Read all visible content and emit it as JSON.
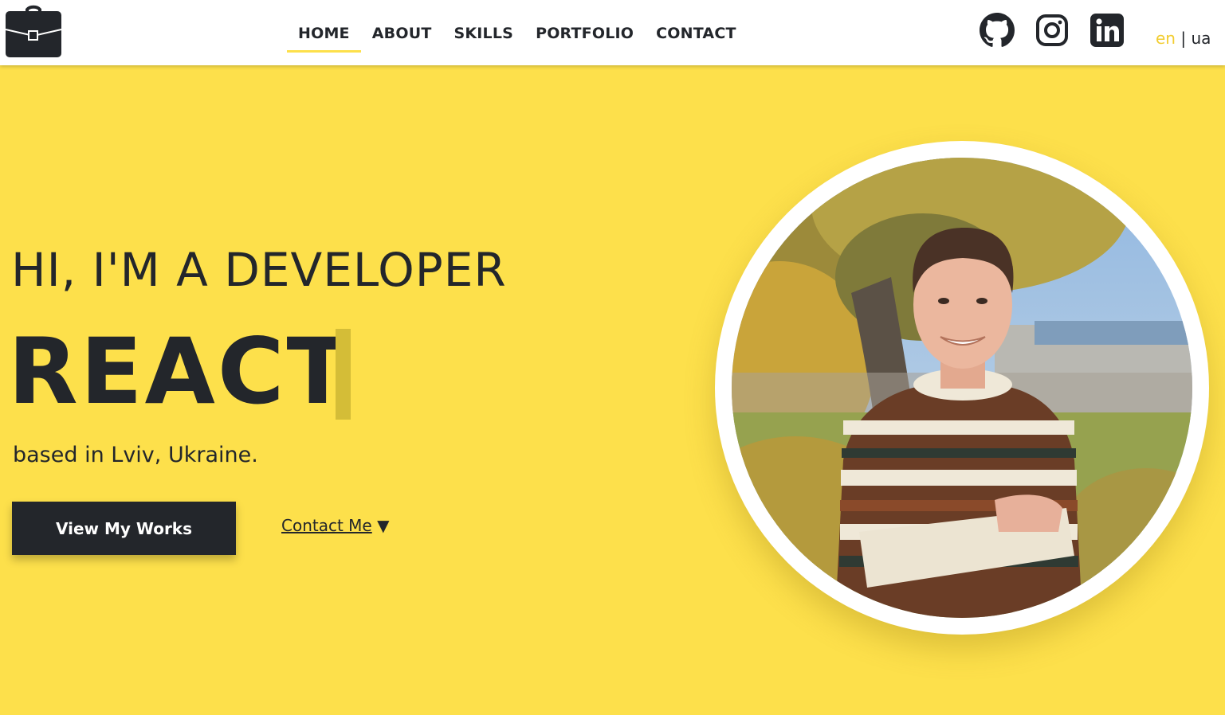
{
  "header": {
    "logo_icon": "briefcase-icon",
    "nav": [
      {
        "label": "HOME",
        "active": true
      },
      {
        "label": "ABOUT",
        "active": false
      },
      {
        "label": "SKILLS",
        "active": false
      },
      {
        "label": "PORTFOLIO",
        "active": false
      },
      {
        "label": "CONTACT",
        "active": false
      }
    ],
    "social_icons": [
      "github-icon",
      "instagram-icon",
      "linkedin-icon"
    ],
    "lang": {
      "en": "en",
      "separator": " | ",
      "ua": "ua"
    }
  },
  "hero": {
    "intro": "HI, I'M A DEVELOPER",
    "word": "REACT",
    "location": "based in Lviv, Ukraine.",
    "primary_button": "View My Works",
    "secondary_link": "Contact Me",
    "secondary_link_icon": "triangle-down-icon"
  },
  "colors": {
    "accent": "#fde04b",
    "dark": "#23262b",
    "lang_active": "#f2cd31"
  }
}
